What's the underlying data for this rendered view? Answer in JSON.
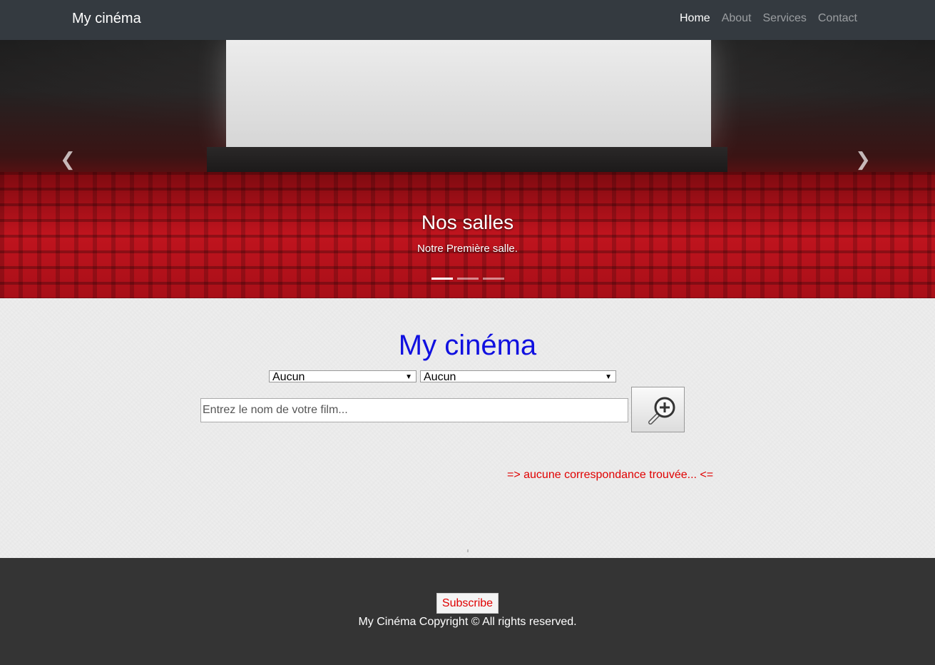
{
  "navbar": {
    "brand": "My cinéma",
    "links": [
      {
        "label": "Home",
        "active": true
      },
      {
        "label": "About",
        "active": false
      },
      {
        "label": "Services",
        "active": false
      },
      {
        "label": "Contact",
        "active": false
      }
    ]
  },
  "carousel": {
    "caption_title": "Nos salles",
    "caption_text": "Notre Première salle.",
    "prev_icon": "chevron-left-icon",
    "next_icon": "chevron-right-icon",
    "slide_count": 3,
    "active_slide": 1
  },
  "main": {
    "title": "My cinéma",
    "select_1": {
      "value": "Aucun"
    },
    "select_2": {
      "value": "Aucun"
    },
    "search": {
      "placeholder": "Entrez le nom de votre film...",
      "value": ""
    },
    "search_button_icon": "magnifier-zoom-icon",
    "no_result": "=> aucune correspondance trouvée... <="
  },
  "footer": {
    "subscribe_label": "Subscribe",
    "copyright": "My Cinéma Copyright © All rights reserved."
  },
  "colors": {
    "navbar_bg": "#343a40",
    "title": "#1010e0",
    "error_text": "#e00000",
    "footer_bg": "#343434"
  }
}
